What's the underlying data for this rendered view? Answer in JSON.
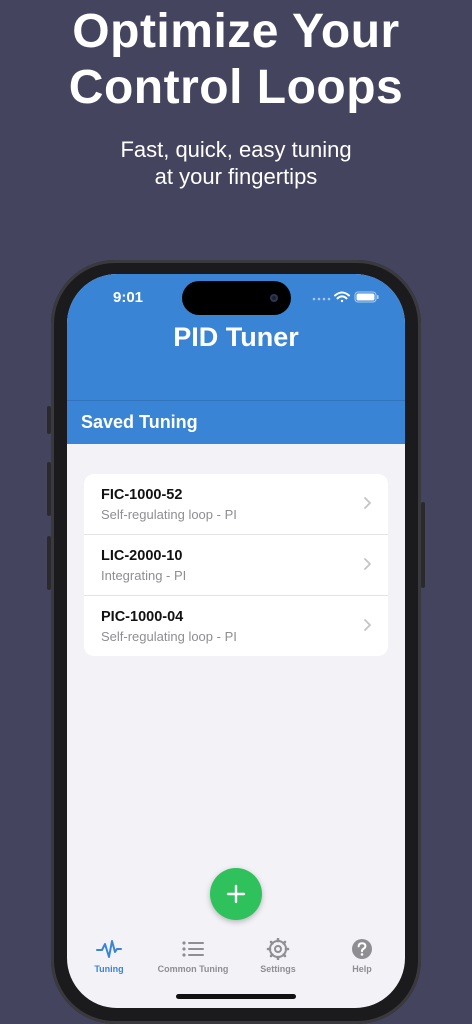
{
  "promo": {
    "headline_line1": "Optimize Your",
    "headline_line2": "Control Loops",
    "subline_line1": "Fast, quick, easy tuning",
    "subline_line2": "at your fingertips"
  },
  "status_bar": {
    "time": "9:01"
  },
  "app": {
    "title": "PID Tuner",
    "section_title": "Saved Tuning",
    "accent_color": "#3a84d6",
    "fab_color": "#2fc15b"
  },
  "saved_tunings": [
    {
      "tag": "FIC-1000-52",
      "description": "Self-regulating loop - PI"
    },
    {
      "tag": "LIC-2000-10",
      "description": "Integrating - PI"
    },
    {
      "tag": "PIC-1000-04",
      "description": "Self-regulating loop - PI"
    }
  ],
  "tab_bar": {
    "tabs": [
      {
        "label": "Tuning",
        "icon": "waveform-icon",
        "active": true
      },
      {
        "label": "Common Tuning",
        "icon": "list-icon",
        "active": false
      },
      {
        "label": "Settings",
        "icon": "gear-icon",
        "active": false
      },
      {
        "label": "Help",
        "icon": "question-circle-icon",
        "active": false
      }
    ]
  }
}
